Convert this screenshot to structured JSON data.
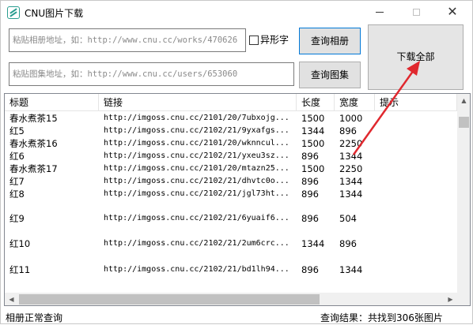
{
  "window": {
    "title": "CNU图片下载"
  },
  "inputs": {
    "album_placeholder": "粘贴相册地址，如：http://www.cnu.cc/works/470626",
    "set_placeholder": "粘贴图集地址，如：http://www.cnu.cc/users/653060"
  },
  "controls": {
    "variant_label": "异形字",
    "query_album_label": "查询相册",
    "query_set_label": "查询图集",
    "download_all_label": "下载全部"
  },
  "table": {
    "headers": [
      "标题",
      "链接",
      "长度",
      "宽度",
      "提示"
    ],
    "rows": [
      {
        "title": "春水煮茶15",
        "link": "http://imgoss.cnu.cc/2101/20/7ubxojg...",
        "length": "1500",
        "width": "1000"
      },
      {
        "title": "红5",
        "link": "http://imgoss.cnu.cc/2102/21/9yxafgs...",
        "length": "1344",
        "width": "896"
      },
      {
        "title": "春水煮茶16",
        "link": "http://imgoss.cnu.cc/2101/20/wknncul...",
        "length": "1500",
        "width": "2250"
      },
      {
        "title": "红6",
        "link": "http://imgoss.cnu.cc/2102/21/yxeu3sz...",
        "length": "896",
        "width": "1344"
      },
      {
        "title": "春水煮茶17",
        "link": "http://imgoss.cnu.cc/2101/20/mtazn25...",
        "length": "1500",
        "width": "2250"
      },
      {
        "title": "红7",
        "link": "http://imgoss.cnu.cc/2102/21/dhvtc0o...",
        "length": "896",
        "width": "1344"
      },
      {
        "title": "红8",
        "link": "http://imgoss.cnu.cc/2102/21/jgl73ht...",
        "length": "896",
        "width": "1344"
      },
      {
        "title": "红9",
        "link": "http://imgoss.cnu.cc/2102/21/6yuaif6...",
        "length": "896",
        "width": "504"
      },
      {
        "title": "红10",
        "link": "http://imgoss.cnu.cc/2102/21/2um6crc...",
        "length": "1344",
        "width": "896"
      },
      {
        "title": "红11",
        "link": "http://imgoss.cnu.cc/2102/21/bd1lh94...",
        "length": "896",
        "width": "1344"
      }
    ]
  },
  "status": {
    "left": "相册正常查询",
    "right": "查询结果：共找到306张图片"
  },
  "colors": {
    "accent": "#0078d7",
    "annotation": "#e0282e"
  }
}
